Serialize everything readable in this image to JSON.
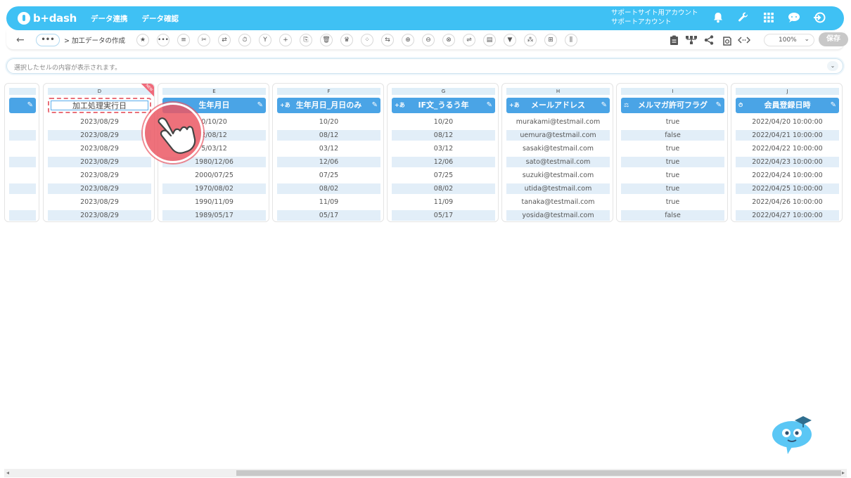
{
  "app": {
    "logo": "b+dash",
    "nav": [
      "データ連携",
      "データ確認"
    ],
    "account_line1": "サポートサイト用アカウント",
    "account_line2": "サポートアカウント"
  },
  "icons_top": [
    "bell-icon",
    "wrench-icon",
    "grid-icon",
    "chat-icon",
    "logout-icon"
  ],
  "toolbar": {
    "back": "←",
    "dots": "•••",
    "breadcrumb": "> 加工データの作成",
    "zoom": "100%",
    "save": "保存",
    "tools": [
      "★",
      "•••",
      "≡",
      "✂",
      "⇄",
      "⏱",
      "Y",
      "+",
      "⎘",
      "🗑",
      "♛",
      "⁘",
      "⇆",
      "⊕",
      "⊖",
      "⊗",
      "⇌",
      "▤",
      "▼",
      "⁂",
      "⊞",
      "⫼"
    ],
    "right_tools": [
      "clipboard-icon",
      "hierarchy-icon",
      "share-icon",
      "refresh-icon",
      "code-icon"
    ]
  },
  "formula": {
    "placeholder": "選択したセルの内容が表示されます。"
  },
  "columns": [
    {
      "letter": "",
      "header": "",
      "icon": "",
      "cells": [
        "",
        "",
        "",
        "",
        "",
        "",
        "",
        ""
      ]
    },
    {
      "letter": "D",
      "header": "加工処理実行日",
      "icon": "",
      "cells": [
        "2023/08/29",
        "2023/08/29",
        "2023/08/29",
        "2023/08/29",
        "2023/08/29",
        "2023/08/29",
        "2023/08/29",
        "2023/08/29"
      ]
    },
    {
      "letter": "E",
      "header": "生年月日",
      "icon": "",
      "cells": [
        "0/10/20",
        "2/08/12",
        "5/03/12",
        "1980/12/06",
        "2000/07/25",
        "1970/08/02",
        "1990/11/09",
        "1989/05/17"
      ]
    },
    {
      "letter": "F",
      "header": "生年月日_月日のみ",
      "icon": "+あ",
      "cells": [
        "10/20",
        "08/12",
        "03/12",
        "12/06",
        "07/25",
        "08/02",
        "11/09",
        "05/17"
      ]
    },
    {
      "letter": "G",
      "header": "IF文_うるう年",
      "icon": "+あ",
      "cells": [
        "10/20",
        "08/12",
        "03/12",
        "12/06",
        "07/25",
        "08/02",
        "11/09",
        "05/17"
      ]
    },
    {
      "letter": "H",
      "header": "メールアドレス",
      "icon": "+あ",
      "cells": [
        "murakami@testmail.com",
        "uemura@testmail.com",
        "sasaki@testmail.com",
        "sato@testmail.com",
        "suzuki@testmail.com",
        "utida@testmail.com",
        "tanaka@testmail.com",
        "yosida@testmail.com"
      ]
    },
    {
      "letter": "I",
      "header": "メルマガ許可フラグ",
      "icon": "⚖",
      "cells": [
        "true",
        "false",
        "true",
        "true",
        "true",
        "true",
        "true",
        "false"
      ]
    },
    {
      "letter": "J",
      "header": "会員登録日時",
      "icon": "⏱",
      "cells": [
        "2022/04/20 10:00:00",
        "2022/04/21 10:00:00",
        "2022/04/22 10:00:00",
        "2022/04/23 10:00:00",
        "2022/04/24 10:00:00",
        "2022/04/25 10:00:00",
        "2022/04/26 10:00:00",
        "2022/04/27 10:00:00"
      ]
    }
  ],
  "new_badge": "NEW"
}
